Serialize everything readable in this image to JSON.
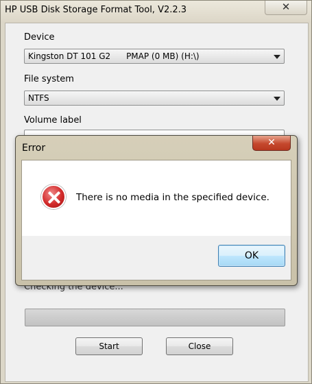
{
  "window": {
    "title": "HP USB Disk Storage Format Tool, V2.2.3",
    "close_glyph": "✕"
  },
  "form": {
    "device_label": "Device",
    "device_value": "Kingston DT 101 G2      PMAP (0 MB) (H:\\)",
    "filesystem_label": "File system",
    "filesystem_value": "NTFS",
    "volume_label": "Volume label",
    "status_text": "Checking the device...",
    "start_label": "Start",
    "close_label": "Close"
  },
  "dialog": {
    "title": "Error",
    "close_glyph": "✕",
    "message": "There is no media in the specified device.",
    "ok_label": "OK",
    "icon": "error-icon"
  },
  "colors": {
    "error_red": "#d22a2a",
    "close_button_red": "#c5482d",
    "ok_button_blue": "#3c7fb1"
  }
}
